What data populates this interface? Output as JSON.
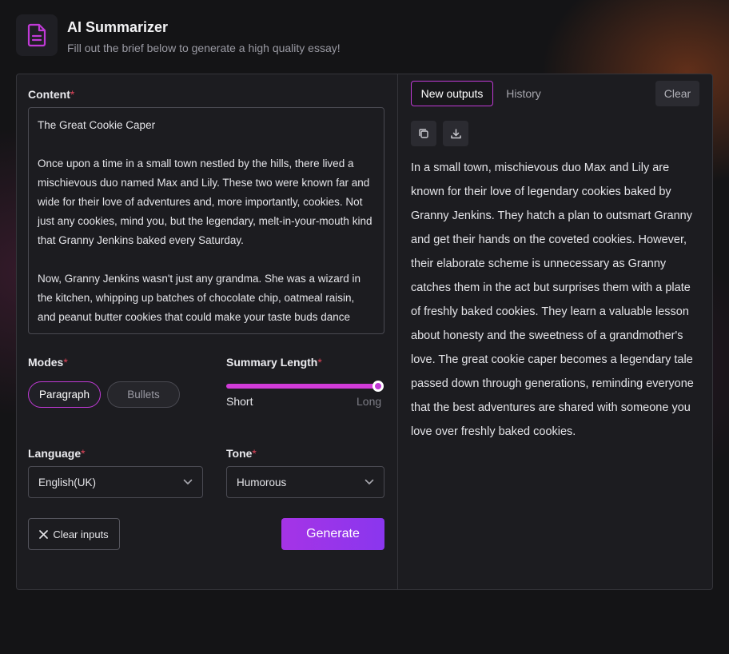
{
  "header": {
    "title": "AI Summarizer",
    "subtitle": "Fill out the brief below to generate a high quality essay!",
    "icon": "document-icon"
  },
  "form": {
    "content_label": "Content",
    "required_mark": "*",
    "content_paragraphs": [
      "The Great Cookie Caper",
      "Once upon a time in a small town nestled by the hills, there lived a mischievous duo named Max and Lily. These two were known far and wide for their love of adventures and, more importantly, cookies. Not just any cookies, mind you, but the legendary, melt-in-your-mouth kind that Granny Jenkins baked every Saturday.",
      "Now, Granny Jenkins wasn't just any grandma. She was a wizard in the kitchen, whipping up batches of chocolate chip, oatmeal raisin, and peanut butter cookies that could make your taste buds dance"
    ],
    "modes_label": "Modes",
    "modes": [
      "Paragraph",
      "Bullets"
    ],
    "selected_mode": "Paragraph",
    "summary_length_label": "Summary Length",
    "slider_min_label": "Short",
    "slider_max_label": "Long",
    "summary_length_value": 1.0,
    "language_label": "Language",
    "language_value": "English(UK)",
    "tone_label": "Tone",
    "tone_value": "Humorous",
    "clear_button_label": "Clear inputs",
    "generate_button_label": "Generate"
  },
  "output": {
    "tabs": [
      "New outputs",
      "History"
    ],
    "active_tab": "New outputs",
    "clear_label": "Clear",
    "actions": [
      "copy-icon",
      "download-icon"
    ],
    "text": "In a small town, mischievous duo Max and Lily are known for their love of legendary cookies baked by Granny Jenkins. They hatch a plan to outsmart Granny and get their hands on the coveted cookies. However, their elaborate scheme is unnecessary as Granny catches them in the act but surprises them with a plate of freshly baked cookies. They learn a valuable lesson about honesty and the sweetness of a grandmother's love. The great cookie caper becomes a legendary tale passed down through generations, reminding everyone that the best adventures are shared with someone you love over freshly baked cookies."
  },
  "colors": {
    "accent": "#c03ad6",
    "generate_gradient_start": "#a534e6",
    "generate_gradient_end": "#8a36ee",
    "required": "#e0455a",
    "panel_bg": "#1c1c20",
    "page_bg": "#141416"
  }
}
